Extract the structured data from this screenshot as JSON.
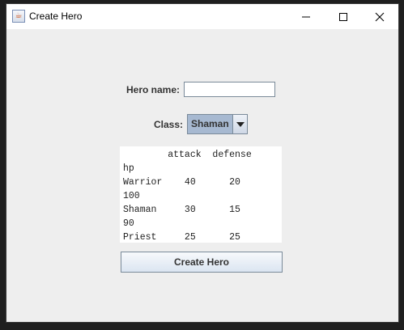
{
  "window": {
    "title": "Create Hero",
    "icon": "java-cup-icon"
  },
  "form": {
    "hero_name_label": "Hero name:",
    "hero_name_value": "",
    "class_label": "Class:",
    "class_selected": "Shaman"
  },
  "stats_text": {
    "lines": [
      "        attack  defense",
      "hp",
      "Warrior    40      20",
      "100",
      "Shaman     30      15",
      "90",
      "Priest     25      25"
    ]
  },
  "buttons": {
    "create_hero": "Create Hero"
  }
}
